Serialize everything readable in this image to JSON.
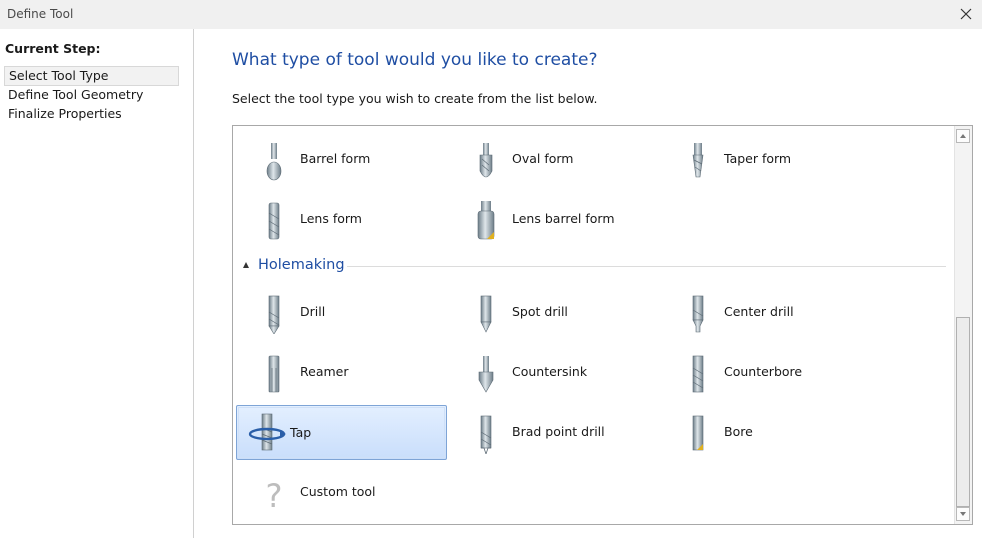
{
  "window": {
    "title": "Define Tool"
  },
  "steps": {
    "header": "Current Step:",
    "items": [
      {
        "label": "Select Tool Type"
      },
      {
        "label": "Define Tool Geometry"
      },
      {
        "label": "Finalize Properties"
      }
    ]
  },
  "main": {
    "title": "What type of tool would you like to create?",
    "subtitle": "Select the tool type you wish to create from the list below."
  },
  "form_tools": [
    {
      "label": "Barrel form",
      "icon": "barrel-form-icon"
    },
    {
      "label": "Oval form",
      "icon": "oval-form-icon"
    },
    {
      "label": "Taper form",
      "icon": "taper-form-icon"
    },
    {
      "label": "Lens form",
      "icon": "lens-form-icon"
    },
    {
      "label": "Lens barrel form",
      "icon": "lens-barrel-form-icon"
    }
  ],
  "holemaking": {
    "header": "Holemaking",
    "items": [
      {
        "label": "Drill",
        "icon": "drill-icon"
      },
      {
        "label": "Spot drill",
        "icon": "spot-drill-icon"
      },
      {
        "label": "Center drill",
        "icon": "center-drill-icon"
      },
      {
        "label": "Reamer",
        "icon": "reamer-icon"
      },
      {
        "label": "Countersink",
        "icon": "countersink-icon"
      },
      {
        "label": "Counterbore",
        "icon": "counterbore-icon"
      },
      {
        "label": "Tap",
        "icon": "tap-icon",
        "selected": true
      },
      {
        "label": "Brad point drill",
        "icon": "brad-point-drill-icon"
      },
      {
        "label": "Bore",
        "icon": "bore-icon"
      },
      {
        "label": "Custom tool",
        "icon": "question-mark-icon"
      }
    ]
  },
  "colors": {
    "accent": "#1f4ea3",
    "selection": "#c9defb",
    "tool_gray": "#8a9aa6",
    "bore_tip": "#e0b020"
  }
}
